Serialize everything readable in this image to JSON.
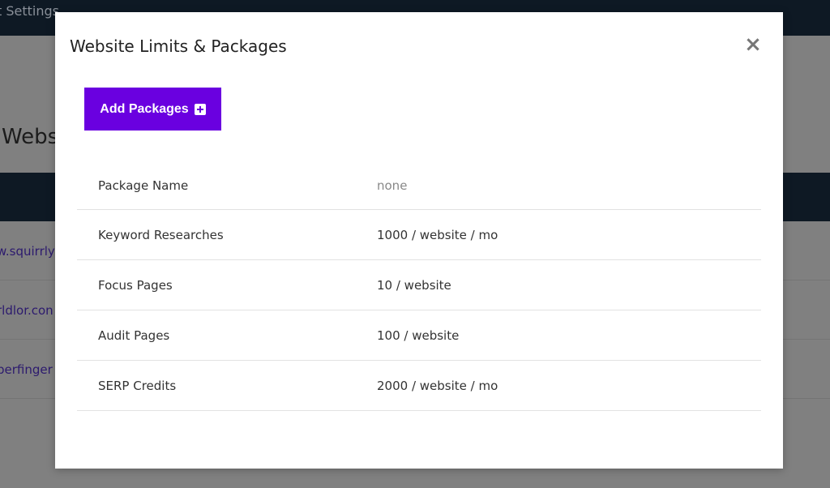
{
  "background": {
    "topbar_text": "t Settings",
    "heading": "Webs",
    "rows": [
      "w.squirrly",
      "rldlor.con",
      "perfinger"
    ]
  },
  "modal": {
    "title": "Website Limits & Packages",
    "close_label": "×",
    "add_button_label": "Add Packages",
    "rows": [
      {
        "key": "Package Name",
        "value": "none"
      },
      {
        "key": "Keyword Researches",
        "value": "1000 / website / mo"
      },
      {
        "key": "Focus Pages",
        "value": "10 / website"
      },
      {
        "key": "Audit Pages",
        "value": "100 / website"
      },
      {
        "key": "SERP Credits",
        "value": "2000 / website / mo"
      }
    ]
  },
  "colors": {
    "accent": "#6a00e0",
    "topbar": "#0e1924",
    "overlay": "#808080"
  }
}
